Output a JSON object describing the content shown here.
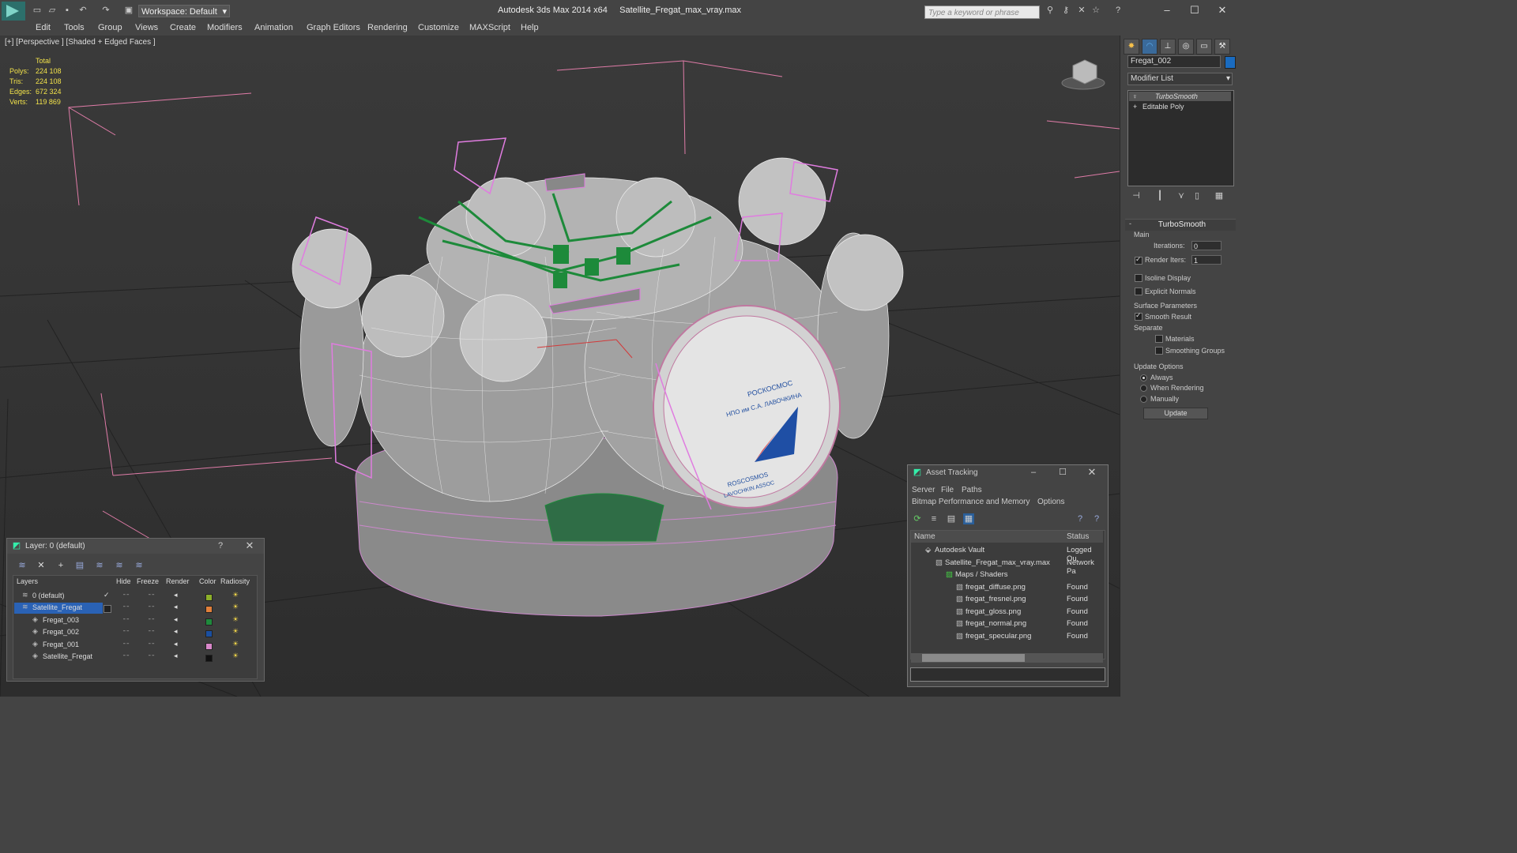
{
  "app": {
    "title": "Autodesk 3ds Max  2014 x64",
    "file": "Satellite_Fregat_max_vray.max",
    "workspace_label": "Workspace: Default",
    "search_placeholder": "Type a keyword or phrase"
  },
  "menu": [
    "Edit",
    "Tools",
    "Group",
    "Views",
    "Create",
    "Modifiers",
    "Animation",
    "Graph Editors",
    "Rendering",
    "Customize",
    "MAXScript",
    "Help"
  ],
  "viewport": {
    "label": "[+] [Perspective ] [Shaded + Edged Faces ]",
    "stats": {
      "header": "Total",
      "polys_label": "Polys:",
      "polys": "224 108",
      "tris_label": "Tris:",
      "tris": "224 108",
      "edges_label": "Edges:",
      "edges": "672 324",
      "verts_label": "Verts:",
      "verts": "119 869"
    },
    "logo_line1": "РОСКОСМОС",
    "logo_line2": "НПО им С.А. ЛАВОЧКИНА",
    "logo_line3": "ROSCOSMOS",
    "logo_line4": "LAVOCHKIN ASSOC"
  },
  "command_panel": {
    "object_name": "Fregat_002",
    "object_color": "#1a6bbf",
    "modifier_list_label": "Modifier List",
    "stack": [
      "TurboSmooth",
      "Editable Poly"
    ],
    "rollout_title": "TurboSmooth",
    "main_group": "Main",
    "iterations_label": "Iterations:",
    "iterations": "0",
    "render_iters_label": "Render Iters:",
    "render_iters": "1",
    "render_iters_checked": true,
    "isoline_label": "Isoline Display",
    "explicit_normals_label": "Explicit Normals",
    "surface_group": "Surface Parameters",
    "smooth_result_label": "Smooth Result",
    "separate_label": "Separate",
    "materials_label": "Materials",
    "smoothing_groups_label": "Smoothing Groups",
    "update_group": "Update Options",
    "always_label": "Always",
    "when_rendering_label": "When Rendering",
    "manually_label": "Manually",
    "update_button": "Update"
  },
  "layer_dialog": {
    "title": "Layer: 0 (default)",
    "help": "?",
    "columns": {
      "layers": "Layers",
      "hide": "Hide",
      "freeze": "Freeze",
      "render": "Render",
      "color": "Color",
      "radiosity": "Radiosity"
    },
    "rows": [
      {
        "name": "0 (default)",
        "color": "#8db02a",
        "selected": false
      },
      {
        "name": "Satellite_Fregat",
        "color": "#e2803a",
        "selected": true
      },
      {
        "name": "Fregat_003",
        "color": "#1f8a3c",
        "selected": false
      },
      {
        "name": "Fregat_002",
        "color": "#1a4fa0",
        "selected": false
      },
      {
        "name": "Fregat_001",
        "color": "#d887c9",
        "selected": false
      },
      {
        "name": "Satellite_Fregat",
        "color": "#111111",
        "selected": false
      }
    ]
  },
  "asset_dialog": {
    "title": "Asset Tracking",
    "menus": [
      "Server",
      "File",
      "Paths"
    ],
    "menus2": [
      "Bitmap Performance and Memory",
      "Options"
    ],
    "col_name": "Name",
    "col_status": "Status",
    "rows": [
      {
        "name": "Autodesk Vault",
        "status": "Logged Ou",
        "indent": 0
      },
      {
        "name": "Satellite_Fregat_max_vray.max",
        "status": "Network Pa",
        "indent": 1
      },
      {
        "name": "Maps / Shaders",
        "status": "",
        "indent": 2
      },
      {
        "name": "fregat_diffuse.png",
        "status": "Found",
        "indent": 3
      },
      {
        "name": "fregat_fresnel.png",
        "status": "Found",
        "indent": 3
      },
      {
        "name": "fregat_gloss.png",
        "status": "Found",
        "indent": 3
      },
      {
        "name": "fregat_normal.png",
        "status": "Found",
        "indent": 3
      },
      {
        "name": "fregat_specular.png",
        "status": "Found",
        "indent": 3
      }
    ]
  }
}
